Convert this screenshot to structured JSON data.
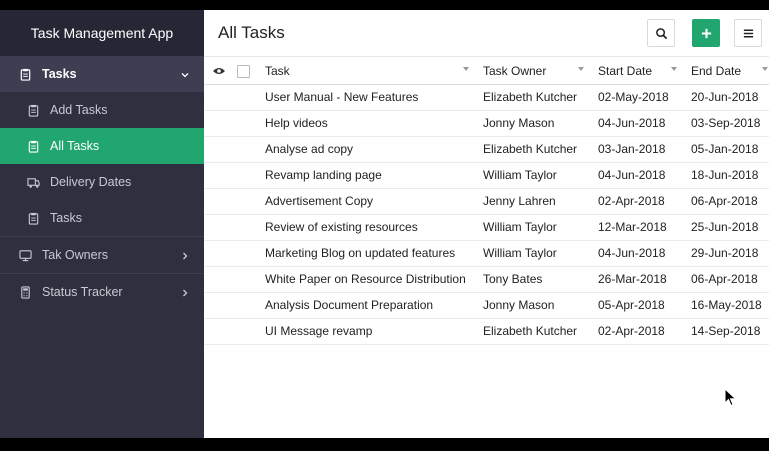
{
  "app": {
    "title": "Task Management App"
  },
  "sidebar": {
    "items": [
      {
        "label": "Tasks",
        "icon": "clipboard-icon",
        "state": "open"
      },
      {
        "label": "Add Tasks",
        "icon": "clipboard-icon"
      },
      {
        "label": "All Tasks",
        "icon": "clipboard-icon",
        "active": true
      },
      {
        "label": "Delivery Dates",
        "icon": "truck-icon"
      },
      {
        "label": "Tasks",
        "icon": "clipboard-icon"
      },
      {
        "label": "Tak Owners",
        "icon": "monitor-icon"
      },
      {
        "label": "Status Tracker",
        "icon": "calculator-icon"
      }
    ]
  },
  "header": {
    "title": "All Tasks"
  },
  "table": {
    "columns": [
      "Task",
      "Task Owner",
      "Start Date",
      "End Date"
    ],
    "rows": [
      [
        "User Manual - New Features",
        "Elizabeth Kutcher",
        "02-May-2018",
        "20-Jun-2018"
      ],
      [
        "Help videos",
        "Jonny Mason",
        "04-Jun-2018",
        "03-Sep-2018"
      ],
      [
        "Analyse ad copy",
        "Elizabeth Kutcher",
        "03-Jan-2018",
        "05-Jan-2018"
      ],
      [
        "Revamp landing page",
        "William Taylor",
        "04-Jun-2018",
        "18-Jun-2018"
      ],
      [
        "Advertisement Copy",
        "Jenny Lahren",
        "02-Apr-2018",
        "06-Apr-2018"
      ],
      [
        "Review of existing resources",
        "William Taylor",
        "12-Mar-2018",
        "25-Jun-2018"
      ],
      [
        "Marketing Blog on updated features",
        "William Taylor",
        "04-Jun-2018",
        "29-Jun-2018"
      ],
      [
        "White Paper on Resource Distribution",
        "Tony Bates",
        "26-Mar-2018",
        "06-Apr-2018"
      ],
      [
        "Analysis Document Preparation",
        "Jonny Mason",
        "05-Apr-2018",
        "16-May-2018"
      ],
      [
        "UI Message revamp",
        "Elizabeth Kutcher",
        "02-Apr-2018",
        "14-Sep-2018"
      ]
    ]
  },
  "colors": {
    "accent": "#21a66f",
    "sidebar": "#2f303f",
    "brand_bar": "#262735"
  }
}
